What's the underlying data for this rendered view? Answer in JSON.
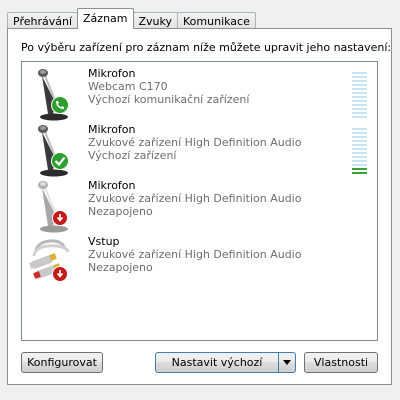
{
  "tabs": [
    {
      "label": "Přehrávání",
      "active": false
    },
    {
      "label": "Záznam",
      "active": true
    },
    {
      "label": "Zvuky",
      "active": false
    },
    {
      "label": "Komunikace",
      "active": false
    }
  ],
  "instruction": "Po výběru zařízení pro záznam níže můžete upravit jeho nastavení:",
  "devices": [
    {
      "name": "Mikrofon",
      "description": "Webcam C170",
      "status": "Výchozí komunikační zařízení",
      "icon": "microphone-icon",
      "badge": "phone-badge-icon",
      "level": 0.0
    },
    {
      "name": "Mikrofon",
      "description": "Zvukové zařízení High Definition Audio",
      "status": "Výchozí zařízení",
      "icon": "microphone-icon",
      "badge": "checkmark-badge-icon",
      "level": 0.15
    },
    {
      "name": "Mikrofon",
      "description": "Zvukové zařízení High Definition Audio",
      "status": "Nezapojeno",
      "icon": "microphone-icon",
      "badge": "unplugged-badge-icon"
    },
    {
      "name": "Vstup",
      "description": "Zvukové zařízení High Definition Audio",
      "status": "Nezapojeno",
      "icon": "rca-cable-icon",
      "badge": "unplugged-badge-icon"
    }
  ],
  "buttons": {
    "configure": "Konfigurovat",
    "set_default": "Nastavit výchozí",
    "properties": "Vlastnosti"
  },
  "colors": {
    "badge_green": "#2e9e2e",
    "badge_red": "#c41a1a",
    "meter_idle": "#c6e5f0",
    "meter_active": "#3aa23a",
    "secondary_text": "#6d6d6d"
  }
}
